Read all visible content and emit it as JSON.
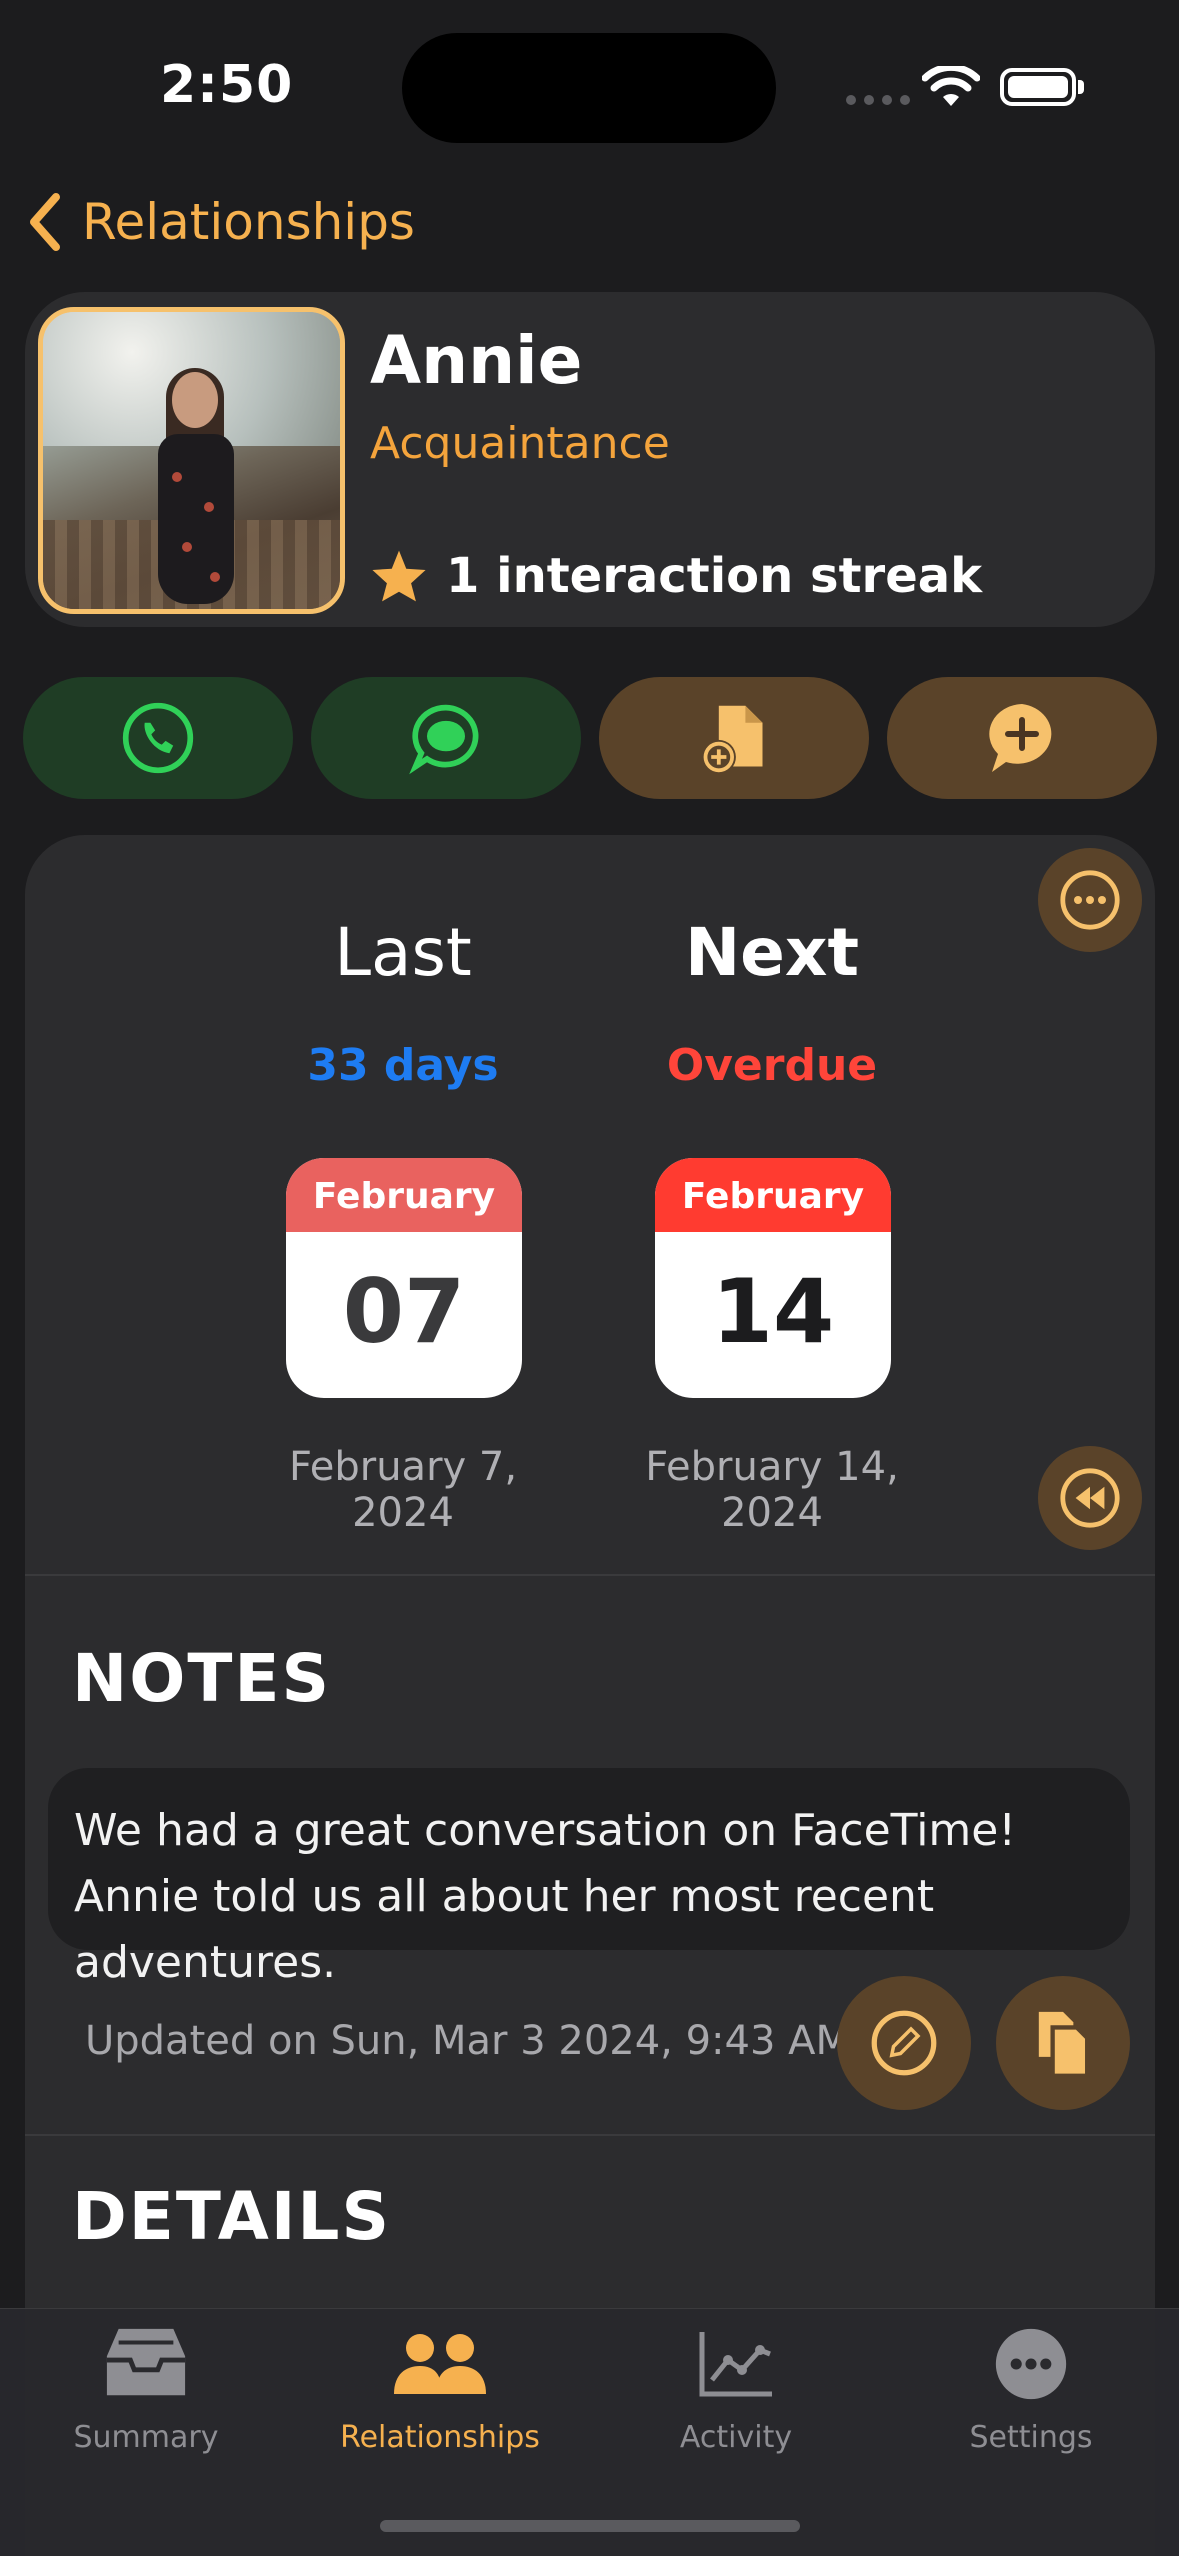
{
  "status_bar": {
    "time": "2:50"
  },
  "nav": {
    "back_label": "Relationships"
  },
  "profile": {
    "name": "Annie",
    "relationship": "Acquaintance",
    "streak": "1 interaction streak"
  },
  "actions": [
    {
      "icon": "phone-icon",
      "color": "#30d158"
    },
    {
      "icon": "message-icon",
      "color": "#30d158"
    },
    {
      "icon": "add-document-icon",
      "color": "#f6c16c"
    },
    {
      "icon": "add-comment-icon",
      "color": "#f6c16c"
    }
  ],
  "schedule": {
    "last": {
      "heading": "Last",
      "status": "33 days",
      "status_color": "#1e7cf2",
      "month": "February",
      "day": "07",
      "date": "February 7, 2024",
      "header_color": "#e9625f"
    },
    "next": {
      "heading": "Next",
      "status": "Overdue",
      "status_color": "#ff453a",
      "month": "February",
      "day": "14",
      "date": "February 14, 2024",
      "header_color": "#ff3b30"
    }
  },
  "notes": {
    "title": "NOTES",
    "text": "We had a great conversation on FaceTime! Annie told us all about her most recent adventures.",
    "updated": "Updated on Sun, Mar 3 2024, 9:43 AM"
  },
  "details": {
    "title": "DETAILS"
  },
  "tabs": [
    {
      "label": "Summary",
      "icon": "tray-icon",
      "active": false
    },
    {
      "label": "Relationships",
      "icon": "people-icon",
      "active": true
    },
    {
      "label": "Activity",
      "icon": "chart-icon",
      "active": false
    },
    {
      "label": "Settings",
      "icon": "more-icon",
      "active": false
    }
  ],
  "colors": {
    "accent": "#f6b14f",
    "background": "#1c1c1e",
    "card": "#2c2c2e"
  }
}
